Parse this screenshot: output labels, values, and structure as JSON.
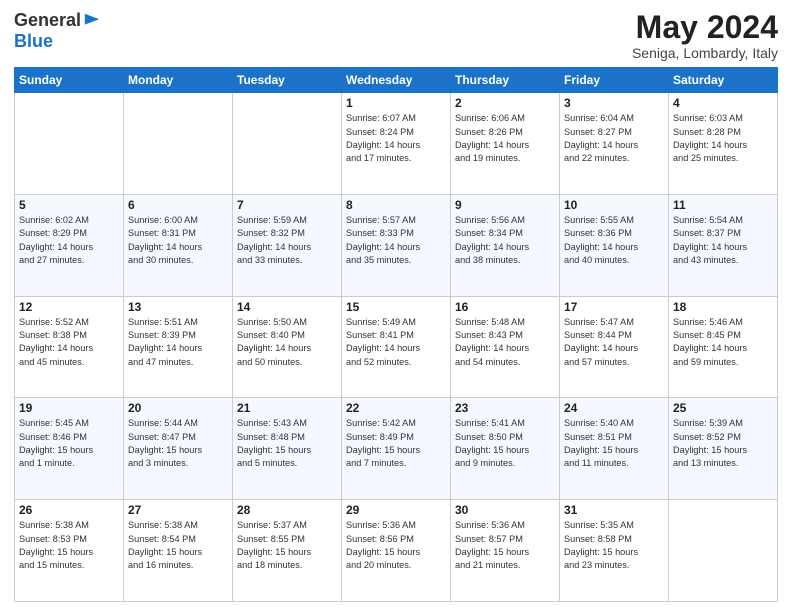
{
  "header": {
    "logo_general": "General",
    "logo_blue": "Blue",
    "month": "May 2024",
    "location": "Seniga, Lombardy, Italy"
  },
  "days_of_week": [
    "Sunday",
    "Monday",
    "Tuesday",
    "Wednesday",
    "Thursday",
    "Friday",
    "Saturday"
  ],
  "weeks": [
    [
      {
        "day": "",
        "info": ""
      },
      {
        "day": "",
        "info": ""
      },
      {
        "day": "",
        "info": ""
      },
      {
        "day": "1",
        "info": "Sunrise: 6:07 AM\nSunset: 8:24 PM\nDaylight: 14 hours\nand 17 minutes."
      },
      {
        "day": "2",
        "info": "Sunrise: 6:06 AM\nSunset: 8:26 PM\nDaylight: 14 hours\nand 19 minutes."
      },
      {
        "day": "3",
        "info": "Sunrise: 6:04 AM\nSunset: 8:27 PM\nDaylight: 14 hours\nand 22 minutes."
      },
      {
        "day": "4",
        "info": "Sunrise: 6:03 AM\nSunset: 8:28 PM\nDaylight: 14 hours\nand 25 minutes."
      }
    ],
    [
      {
        "day": "5",
        "info": "Sunrise: 6:02 AM\nSunset: 8:29 PM\nDaylight: 14 hours\nand 27 minutes."
      },
      {
        "day": "6",
        "info": "Sunrise: 6:00 AM\nSunset: 8:31 PM\nDaylight: 14 hours\nand 30 minutes."
      },
      {
        "day": "7",
        "info": "Sunrise: 5:59 AM\nSunset: 8:32 PM\nDaylight: 14 hours\nand 33 minutes."
      },
      {
        "day": "8",
        "info": "Sunrise: 5:57 AM\nSunset: 8:33 PM\nDaylight: 14 hours\nand 35 minutes."
      },
      {
        "day": "9",
        "info": "Sunrise: 5:56 AM\nSunset: 8:34 PM\nDaylight: 14 hours\nand 38 minutes."
      },
      {
        "day": "10",
        "info": "Sunrise: 5:55 AM\nSunset: 8:36 PM\nDaylight: 14 hours\nand 40 minutes."
      },
      {
        "day": "11",
        "info": "Sunrise: 5:54 AM\nSunset: 8:37 PM\nDaylight: 14 hours\nand 43 minutes."
      }
    ],
    [
      {
        "day": "12",
        "info": "Sunrise: 5:52 AM\nSunset: 8:38 PM\nDaylight: 14 hours\nand 45 minutes."
      },
      {
        "day": "13",
        "info": "Sunrise: 5:51 AM\nSunset: 8:39 PM\nDaylight: 14 hours\nand 47 minutes."
      },
      {
        "day": "14",
        "info": "Sunrise: 5:50 AM\nSunset: 8:40 PM\nDaylight: 14 hours\nand 50 minutes."
      },
      {
        "day": "15",
        "info": "Sunrise: 5:49 AM\nSunset: 8:41 PM\nDaylight: 14 hours\nand 52 minutes."
      },
      {
        "day": "16",
        "info": "Sunrise: 5:48 AM\nSunset: 8:43 PM\nDaylight: 14 hours\nand 54 minutes."
      },
      {
        "day": "17",
        "info": "Sunrise: 5:47 AM\nSunset: 8:44 PM\nDaylight: 14 hours\nand 57 minutes."
      },
      {
        "day": "18",
        "info": "Sunrise: 5:46 AM\nSunset: 8:45 PM\nDaylight: 14 hours\nand 59 minutes."
      }
    ],
    [
      {
        "day": "19",
        "info": "Sunrise: 5:45 AM\nSunset: 8:46 PM\nDaylight: 15 hours\nand 1 minute."
      },
      {
        "day": "20",
        "info": "Sunrise: 5:44 AM\nSunset: 8:47 PM\nDaylight: 15 hours\nand 3 minutes."
      },
      {
        "day": "21",
        "info": "Sunrise: 5:43 AM\nSunset: 8:48 PM\nDaylight: 15 hours\nand 5 minutes."
      },
      {
        "day": "22",
        "info": "Sunrise: 5:42 AM\nSunset: 8:49 PM\nDaylight: 15 hours\nand 7 minutes."
      },
      {
        "day": "23",
        "info": "Sunrise: 5:41 AM\nSunset: 8:50 PM\nDaylight: 15 hours\nand 9 minutes."
      },
      {
        "day": "24",
        "info": "Sunrise: 5:40 AM\nSunset: 8:51 PM\nDaylight: 15 hours\nand 11 minutes."
      },
      {
        "day": "25",
        "info": "Sunrise: 5:39 AM\nSunset: 8:52 PM\nDaylight: 15 hours\nand 13 minutes."
      }
    ],
    [
      {
        "day": "26",
        "info": "Sunrise: 5:38 AM\nSunset: 8:53 PM\nDaylight: 15 hours\nand 15 minutes."
      },
      {
        "day": "27",
        "info": "Sunrise: 5:38 AM\nSunset: 8:54 PM\nDaylight: 15 hours\nand 16 minutes."
      },
      {
        "day": "28",
        "info": "Sunrise: 5:37 AM\nSunset: 8:55 PM\nDaylight: 15 hours\nand 18 minutes."
      },
      {
        "day": "29",
        "info": "Sunrise: 5:36 AM\nSunset: 8:56 PM\nDaylight: 15 hours\nand 20 minutes."
      },
      {
        "day": "30",
        "info": "Sunrise: 5:36 AM\nSunset: 8:57 PM\nDaylight: 15 hours\nand 21 minutes."
      },
      {
        "day": "31",
        "info": "Sunrise: 5:35 AM\nSunset: 8:58 PM\nDaylight: 15 hours\nand 23 minutes."
      },
      {
        "day": "",
        "info": ""
      }
    ]
  ]
}
